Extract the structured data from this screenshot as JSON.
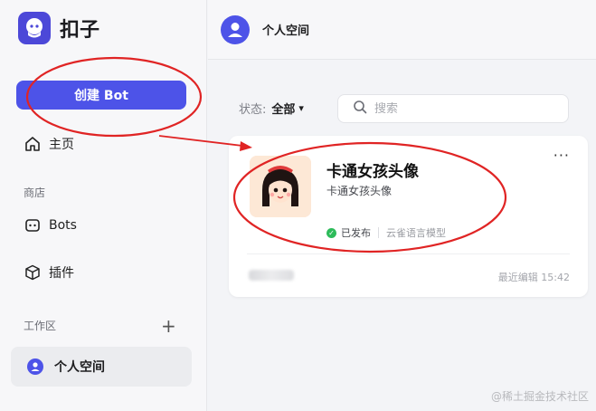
{
  "app": {
    "title": "扣子"
  },
  "sidebar": {
    "create_button": "创建 Bot",
    "home": "主页",
    "store_section": "商店",
    "bots": "Bots",
    "plugins": "插件",
    "workspace_section": "工作区",
    "add_icon": "+",
    "personal_space": "个人空间"
  },
  "topbar": {
    "title": "个人空间"
  },
  "filter": {
    "label": "状态:",
    "value": "全部",
    "caret": "▾"
  },
  "search": {
    "placeholder": "搜索"
  },
  "card": {
    "name": "卡通女孩头像",
    "description": "卡通女孩头像",
    "status": "已发布",
    "model": "云雀语言模型",
    "more": "···",
    "edited": "最近编辑 15:42"
  },
  "watermark": "@稀土掘金技术社区",
  "colors": {
    "accent": "#4d53e8",
    "annotation": "#e02424",
    "published": "#2dbb5a"
  }
}
